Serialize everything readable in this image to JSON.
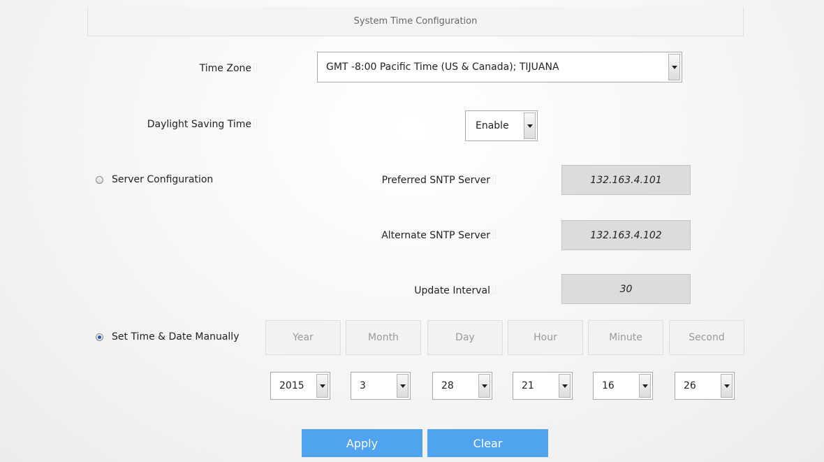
{
  "header": {
    "title": "System Time Configuration"
  },
  "time_zone": {
    "label": "Time Zone",
    "value": "GMT -8:00 Pacific Time (US & Canada); TIJUANA"
  },
  "dst": {
    "label": "Daylight Saving Time",
    "value": "Enable"
  },
  "server_config": {
    "radio_label": "Server Configuration",
    "selected": false,
    "preferred": {
      "label": "Preferred SNTP Server",
      "value": "132.163.4.101"
    },
    "alternate": {
      "label": "Alternate SNTP Server",
      "value": "132.163.4.102"
    },
    "interval": {
      "label": "Update Interval",
      "value": "30"
    }
  },
  "manual": {
    "radio_label": "Set Time & Date Manually",
    "selected": true,
    "fields": [
      {
        "header": "Year",
        "value": "2015"
      },
      {
        "header": "Month",
        "value": "3"
      },
      {
        "header": "Day",
        "value": "28"
      },
      {
        "header": "Hour",
        "value": "21"
      },
      {
        "header": "Minute",
        "value": "16"
      },
      {
        "header": "Second",
        "value": "26"
      }
    ]
  },
  "buttons": {
    "apply": "Apply",
    "clear": "Clear"
  },
  "colors": {
    "button_bg": "#4fa3ef",
    "readonly_input_bg": "#dcdcdc",
    "radio_selected": "#2456a8"
  },
  "icons": {
    "dropdown": "chevron-down-icon",
    "required": "required-marker-icon"
  }
}
